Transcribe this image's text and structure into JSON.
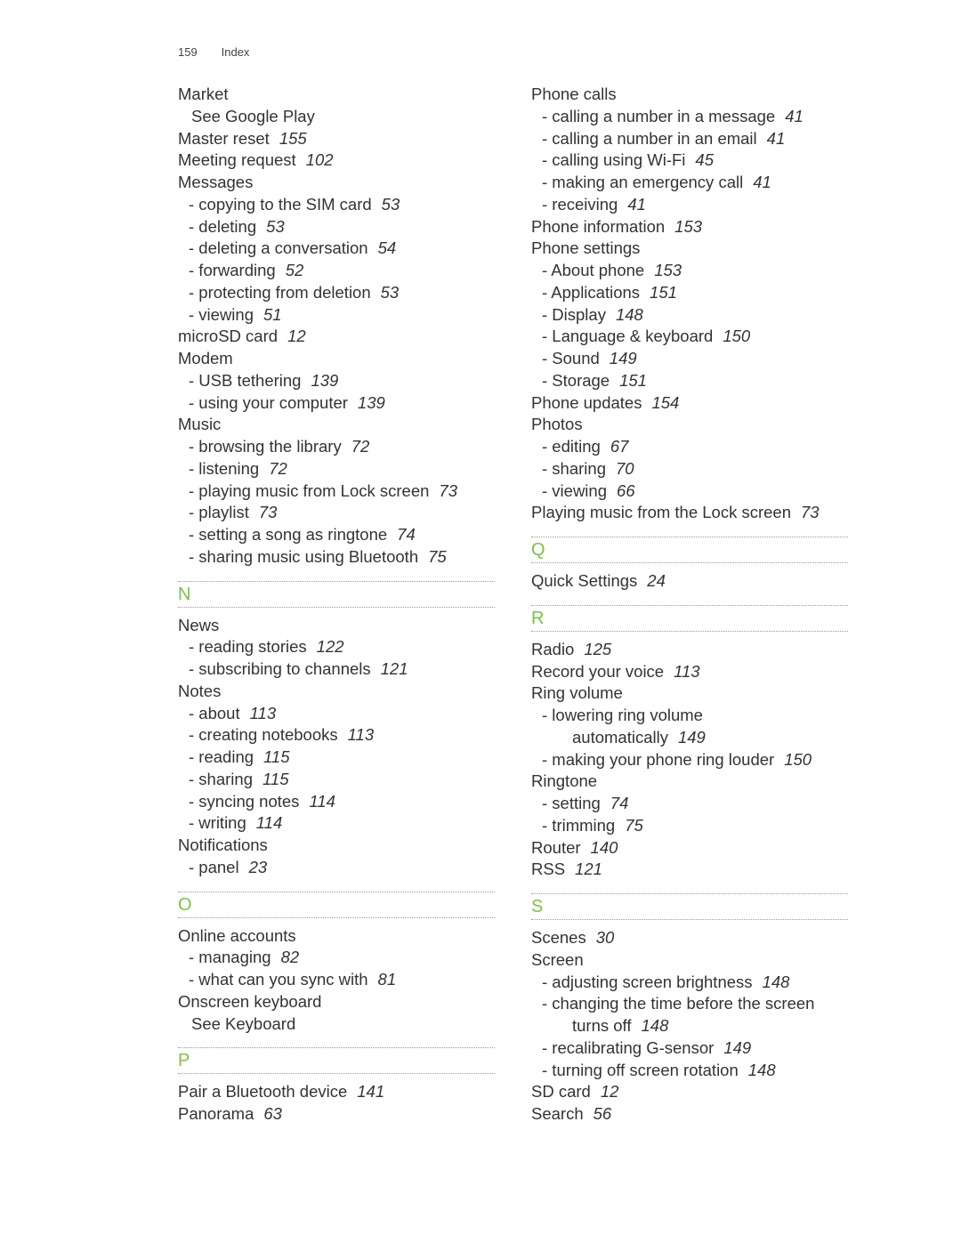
{
  "header": {
    "page_number": "159",
    "section": "Index"
  },
  "accent_color": "#7dc242",
  "left_column": [
    {
      "type": "entry",
      "text": "Market"
    },
    {
      "type": "see",
      "text": "See Google Play"
    },
    {
      "type": "entry",
      "text": "Master reset",
      "page": "155"
    },
    {
      "type": "entry",
      "text": "Meeting request",
      "page": "102"
    },
    {
      "type": "entry",
      "text": "Messages"
    },
    {
      "type": "sub",
      "text": "- copying to the SIM card",
      "page": "53"
    },
    {
      "type": "sub",
      "text": "- deleting",
      "page": "53"
    },
    {
      "type": "sub",
      "text": "- deleting a conversation",
      "page": "54"
    },
    {
      "type": "sub",
      "text": "- forwarding",
      "page": "52"
    },
    {
      "type": "sub",
      "text": "- protecting from deletion",
      "page": "53"
    },
    {
      "type": "sub",
      "text": "- viewing",
      "page": "51"
    },
    {
      "type": "entry",
      "text": "microSD card",
      "page": "12"
    },
    {
      "type": "entry",
      "text": "Modem"
    },
    {
      "type": "sub",
      "text": "- USB tethering",
      "page": "139"
    },
    {
      "type": "sub",
      "text": "- using your computer",
      "page": "139"
    },
    {
      "type": "entry",
      "text": "Music"
    },
    {
      "type": "sub",
      "text": "- browsing the library",
      "page": "72"
    },
    {
      "type": "sub",
      "text": "- listening",
      "page": "72"
    },
    {
      "type": "sub",
      "text": "- playing music from Lock screen",
      "page": "73"
    },
    {
      "type": "sub",
      "text": "- playlist",
      "page": "73"
    },
    {
      "type": "sub",
      "text": "- setting a song as ringtone",
      "page": "74"
    },
    {
      "type": "sub",
      "text": "- sharing music using Bluetooth",
      "page": "75"
    },
    {
      "type": "letter",
      "text": "N"
    },
    {
      "type": "entry",
      "text": "News"
    },
    {
      "type": "sub",
      "text": "- reading stories",
      "page": "122"
    },
    {
      "type": "sub",
      "text": "- subscribing to channels",
      "page": "121"
    },
    {
      "type": "entry",
      "text": "Notes"
    },
    {
      "type": "sub",
      "text": "- about",
      "page": "113"
    },
    {
      "type": "sub",
      "text": "- creating notebooks",
      "page": "113"
    },
    {
      "type": "sub",
      "text": "- reading",
      "page": "115"
    },
    {
      "type": "sub",
      "text": "- sharing",
      "page": "115"
    },
    {
      "type": "sub",
      "text": "- syncing notes",
      "page": "114"
    },
    {
      "type": "sub",
      "text": "- writing",
      "page": "114"
    },
    {
      "type": "entry",
      "text": "Notifications"
    },
    {
      "type": "sub",
      "text": "- panel",
      "page": "23"
    },
    {
      "type": "letter",
      "text": "O"
    },
    {
      "type": "entry",
      "text": "Online accounts"
    },
    {
      "type": "sub",
      "text": "- managing",
      "page": "82"
    },
    {
      "type": "sub",
      "text": "- what can you sync with",
      "page": "81"
    },
    {
      "type": "entry",
      "text": "Onscreen keyboard"
    },
    {
      "type": "see",
      "text": "See Keyboard"
    },
    {
      "type": "letter",
      "text": "P"
    },
    {
      "type": "entry",
      "text": "Pair a Bluetooth device",
      "page": "141"
    },
    {
      "type": "entry",
      "text": "Panorama",
      "page": "63"
    }
  ],
  "right_column": [
    {
      "type": "entry",
      "text": "Phone calls"
    },
    {
      "type": "sub",
      "text": "- calling a number in a message",
      "page": "41"
    },
    {
      "type": "sub",
      "text": "- calling a number in an email",
      "page": "41"
    },
    {
      "type": "sub",
      "text": "- calling using Wi-Fi",
      "page": "45"
    },
    {
      "type": "sub",
      "text": "- making an emergency call",
      "page": "41"
    },
    {
      "type": "sub",
      "text": "- receiving",
      "page": "41"
    },
    {
      "type": "entry",
      "text": "Phone information",
      "page": "153"
    },
    {
      "type": "entry",
      "text": "Phone settings"
    },
    {
      "type": "sub",
      "text": "- About phone",
      "page": "153"
    },
    {
      "type": "sub",
      "text": "- Applications",
      "page": "151"
    },
    {
      "type": "sub",
      "text": "- Display",
      "page": "148"
    },
    {
      "type": "sub",
      "text": "- Language & keyboard",
      "page": "150"
    },
    {
      "type": "sub",
      "text": "- Sound",
      "page": "149"
    },
    {
      "type": "sub",
      "text": "- Storage",
      "page": "151"
    },
    {
      "type": "entry",
      "text": "Phone updates",
      "page": "154"
    },
    {
      "type": "entry",
      "text": "Photos"
    },
    {
      "type": "sub",
      "text": "- editing",
      "page": "67"
    },
    {
      "type": "sub",
      "text": "- sharing",
      "page": "70"
    },
    {
      "type": "sub",
      "text": "- viewing",
      "page": "66"
    },
    {
      "type": "entry",
      "text": "Playing music from the Lock screen",
      "page": "73"
    },
    {
      "type": "letter",
      "text": "Q"
    },
    {
      "type": "entry",
      "text": "Quick Settings",
      "page": "24"
    },
    {
      "type": "letter",
      "text": "R"
    },
    {
      "type": "entry",
      "text": "Radio",
      "page": "125"
    },
    {
      "type": "entry",
      "text": "Record your voice",
      "page": "113"
    },
    {
      "type": "entry",
      "text": "Ring volume"
    },
    {
      "type": "sub",
      "text": "- lowering ring volume"
    },
    {
      "type": "cont",
      "text": "automatically",
      "page": "149"
    },
    {
      "type": "sub",
      "text": "- making your phone ring louder",
      "page": "150"
    },
    {
      "type": "entry",
      "text": "Ringtone"
    },
    {
      "type": "sub",
      "text": "- setting",
      "page": "74"
    },
    {
      "type": "sub",
      "text": "- trimming",
      "page": "75"
    },
    {
      "type": "entry",
      "text": "Router",
      "page": "140"
    },
    {
      "type": "entry",
      "text": "RSS",
      "page": "121"
    },
    {
      "type": "letter",
      "text": "S"
    },
    {
      "type": "entry",
      "text": "Scenes",
      "page": "30"
    },
    {
      "type": "entry",
      "text": "Screen"
    },
    {
      "type": "sub",
      "text": "- adjusting screen brightness",
      "page": "148"
    },
    {
      "type": "sub",
      "text": "- changing the time before the screen"
    },
    {
      "type": "cont",
      "text": "turns off",
      "page": "148"
    },
    {
      "type": "sub",
      "text": "- recalibrating G-sensor",
      "page": "149"
    },
    {
      "type": "sub",
      "text": "- turning off screen rotation",
      "page": "148"
    },
    {
      "type": "entry",
      "text": "SD card",
      "page": "12"
    },
    {
      "type": "entry",
      "text": "Search",
      "page": "56"
    }
  ]
}
